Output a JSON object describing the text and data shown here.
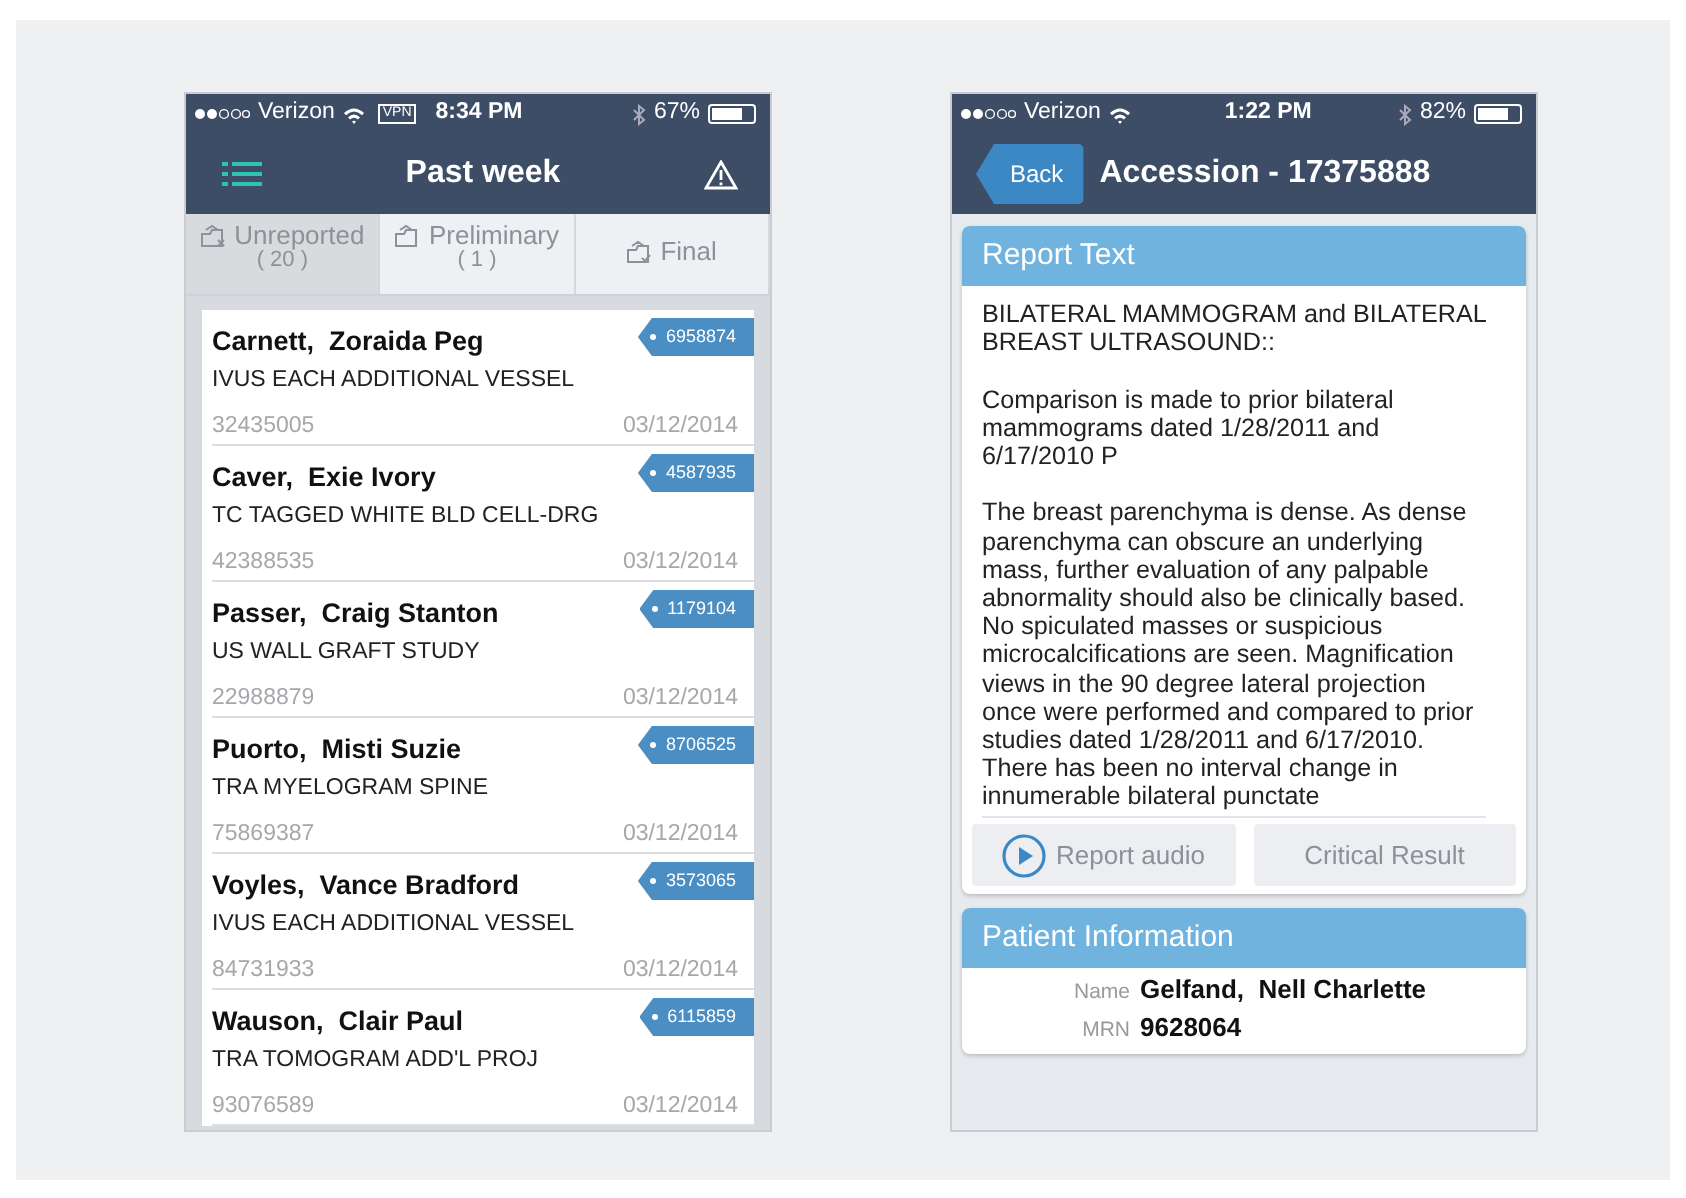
{
  "left_phone": {
    "status_bar": {
      "carrier": "Verizon",
      "vpn": "VPN",
      "time": "8:34 PM",
      "battery": "67%"
    },
    "nav": {
      "title": "Past week"
    },
    "tabs": [
      {
        "label": "Unreported",
        "count": "( 20 )",
        "kind": "unreported",
        "selected": true
      },
      {
        "label": "Preliminary",
        "count": "( 1 )",
        "kind": "preliminary",
        "selected": false
      },
      {
        "label": "Final",
        "kind": "final",
        "selected": false
      }
    ],
    "studies": [
      {
        "name": "Carnett,  Zoraida Peg",
        "procedure": "IVUS EACH ADDITIONAL VESSEL",
        "number": "32435005",
        "date": "03/12/2014",
        "accession": "6958874"
      },
      {
        "name": "Caver,  Exie Ivory",
        "procedure": "TC TAGGED WHITE BLD CELL-DRG",
        "number": "42388535",
        "date": "03/12/2014",
        "accession": "4587935"
      },
      {
        "name": "Passer,  Craig Stanton",
        "procedure": "US WALL GRAFT STUDY",
        "number": "22988879",
        "date": "03/12/2014",
        "accession": "1179104"
      },
      {
        "name": "Puorto,  Misti Suzie",
        "procedure": "TRA MYELOGRAM SPINE",
        "number": "75869387",
        "date": "03/12/2014",
        "accession": "8706525"
      },
      {
        "name": "Voyles,  Vance Bradford",
        "procedure": "IVUS EACH ADDITIONAL VESSEL",
        "number": "84731933",
        "date": "03/12/2014",
        "accession": "3573065"
      },
      {
        "name": "Wauson,  Clair Paul",
        "procedure": "TRA TOMOGRAM ADD'L PROJ",
        "number": "93076589",
        "date": "03/12/2014",
        "accession": "6115859"
      }
    ]
  },
  "right_phone": {
    "status_bar": {
      "carrier": "Verizon",
      "time": "1:22 PM",
      "battery": "82%"
    },
    "nav": {
      "back": "Back",
      "title": "Accession - 17375888"
    },
    "report": {
      "title": "Report Text",
      "paragraphs": [
        "BILATERAL MAMMOGRAM and BILATERAL BREAST ULTRASOUND::",
        "Comparison is made  to prior bilateral mammograms dated 1/28/2011 and 6/17/2010 P",
        "The breast parenchyma is dense. As dense parenchyma can obscure an underlying mass, further evaluation of any palpable abnormality should also be clinically based. No spiculated masses or suspicious microcalcifications are seen. Magnification views in the 90 degree lateral projection once were performed and compared to prior studies dated 1/28/2011 and 6/17/2010. There has been no interval change in innumerable bilateral punctate"
      ],
      "buttons": [
        {
          "label": "Report audio",
          "kind": "audio"
        },
        {
          "label": "Critical Result",
          "kind": "plain"
        }
      ]
    },
    "patient": {
      "title": "Patient Information",
      "fields": [
        {
          "label": "Name",
          "value": "Gelfand,  Nell Charlette"
        },
        {
          "label": "MRN",
          "value": "9628064"
        }
      ]
    }
  }
}
